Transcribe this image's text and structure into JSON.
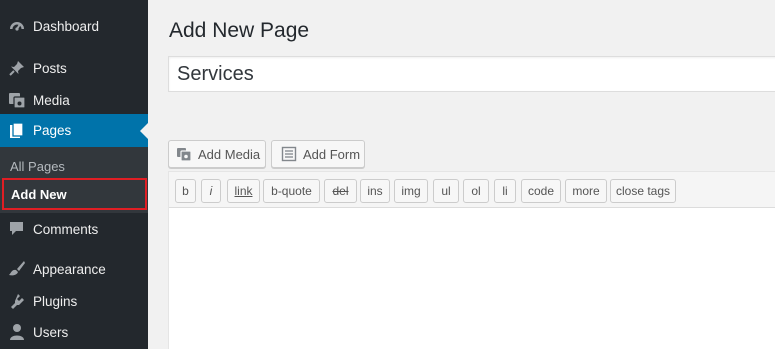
{
  "sidebar": {
    "items": [
      {
        "label": "Dashboard",
        "icon": "dashboard-icon"
      },
      {
        "label": "Posts",
        "icon": "pin-icon"
      },
      {
        "label": "Media",
        "icon": "media-icon"
      },
      {
        "label": "Pages",
        "icon": "pages-icon"
      },
      {
        "label": "Comments",
        "icon": "comment-icon"
      },
      {
        "label": "Appearance",
        "icon": "paintbrush-icon"
      },
      {
        "label": "Plugins",
        "icon": "plugin-icon"
      },
      {
        "label": "Users",
        "icon": "user-icon"
      }
    ],
    "submenu": {
      "all_pages": "All Pages",
      "add_new": "Add New"
    },
    "active": "Pages",
    "accent_color": "#0073aa",
    "highlight_color": "#e01e24"
  },
  "main": {
    "page_title": "Add New Page",
    "title_value": "Services",
    "media_buttons": {
      "add_media": "Add Media",
      "add_form": "Add Form"
    },
    "quicktags": [
      "b",
      "i",
      "link",
      "b-quote",
      "del",
      "ins",
      "img",
      "ul",
      "ol",
      "li",
      "code",
      "more",
      "close tags"
    ]
  }
}
